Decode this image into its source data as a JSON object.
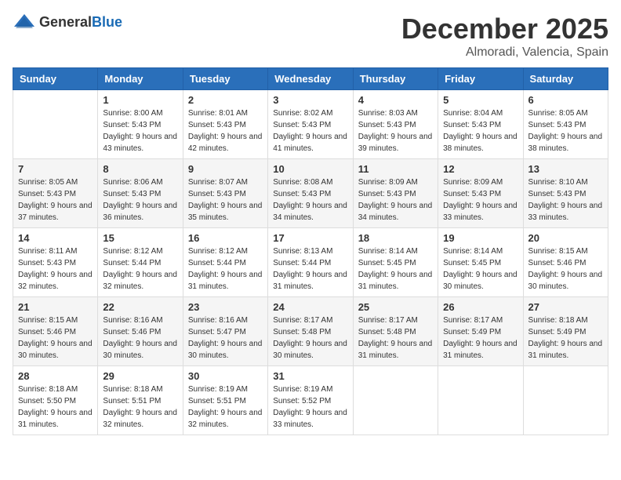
{
  "logo": {
    "general": "General",
    "blue": "Blue"
  },
  "header": {
    "month": "December 2025",
    "location": "Almoradi, Valencia, Spain"
  },
  "days_of_week": [
    "Sunday",
    "Monday",
    "Tuesday",
    "Wednesday",
    "Thursday",
    "Friday",
    "Saturday"
  ],
  "weeks": [
    [
      {
        "day": "",
        "sunrise": "",
        "sunset": "",
        "daylight": ""
      },
      {
        "day": "1",
        "sunrise": "Sunrise: 8:00 AM",
        "sunset": "Sunset: 5:43 PM",
        "daylight": "Daylight: 9 hours and 43 minutes."
      },
      {
        "day": "2",
        "sunrise": "Sunrise: 8:01 AM",
        "sunset": "Sunset: 5:43 PM",
        "daylight": "Daylight: 9 hours and 42 minutes."
      },
      {
        "day": "3",
        "sunrise": "Sunrise: 8:02 AM",
        "sunset": "Sunset: 5:43 PM",
        "daylight": "Daylight: 9 hours and 41 minutes."
      },
      {
        "day": "4",
        "sunrise": "Sunrise: 8:03 AM",
        "sunset": "Sunset: 5:43 PM",
        "daylight": "Daylight: 9 hours and 39 minutes."
      },
      {
        "day": "5",
        "sunrise": "Sunrise: 8:04 AM",
        "sunset": "Sunset: 5:43 PM",
        "daylight": "Daylight: 9 hours and 38 minutes."
      },
      {
        "day": "6",
        "sunrise": "Sunrise: 8:05 AM",
        "sunset": "Sunset: 5:43 PM",
        "daylight": "Daylight: 9 hours and 38 minutes."
      }
    ],
    [
      {
        "day": "7",
        "sunrise": "Sunrise: 8:05 AM",
        "sunset": "Sunset: 5:43 PM",
        "daylight": "Daylight: 9 hours and 37 minutes."
      },
      {
        "day": "8",
        "sunrise": "Sunrise: 8:06 AM",
        "sunset": "Sunset: 5:43 PM",
        "daylight": "Daylight: 9 hours and 36 minutes."
      },
      {
        "day": "9",
        "sunrise": "Sunrise: 8:07 AM",
        "sunset": "Sunset: 5:43 PM",
        "daylight": "Daylight: 9 hours and 35 minutes."
      },
      {
        "day": "10",
        "sunrise": "Sunrise: 8:08 AM",
        "sunset": "Sunset: 5:43 PM",
        "daylight": "Daylight: 9 hours and 34 minutes."
      },
      {
        "day": "11",
        "sunrise": "Sunrise: 8:09 AM",
        "sunset": "Sunset: 5:43 PM",
        "daylight": "Daylight: 9 hours and 34 minutes."
      },
      {
        "day": "12",
        "sunrise": "Sunrise: 8:09 AM",
        "sunset": "Sunset: 5:43 PM",
        "daylight": "Daylight: 9 hours and 33 minutes."
      },
      {
        "day": "13",
        "sunrise": "Sunrise: 8:10 AM",
        "sunset": "Sunset: 5:43 PM",
        "daylight": "Daylight: 9 hours and 33 minutes."
      }
    ],
    [
      {
        "day": "14",
        "sunrise": "Sunrise: 8:11 AM",
        "sunset": "Sunset: 5:43 PM",
        "daylight": "Daylight: 9 hours and 32 minutes."
      },
      {
        "day": "15",
        "sunrise": "Sunrise: 8:12 AM",
        "sunset": "Sunset: 5:44 PM",
        "daylight": "Daylight: 9 hours and 32 minutes."
      },
      {
        "day": "16",
        "sunrise": "Sunrise: 8:12 AM",
        "sunset": "Sunset: 5:44 PM",
        "daylight": "Daylight: 9 hours and 31 minutes."
      },
      {
        "day": "17",
        "sunrise": "Sunrise: 8:13 AM",
        "sunset": "Sunset: 5:44 PM",
        "daylight": "Daylight: 9 hours and 31 minutes."
      },
      {
        "day": "18",
        "sunrise": "Sunrise: 8:14 AM",
        "sunset": "Sunset: 5:45 PM",
        "daylight": "Daylight: 9 hours and 31 minutes."
      },
      {
        "day": "19",
        "sunrise": "Sunrise: 8:14 AM",
        "sunset": "Sunset: 5:45 PM",
        "daylight": "Daylight: 9 hours and 30 minutes."
      },
      {
        "day": "20",
        "sunrise": "Sunrise: 8:15 AM",
        "sunset": "Sunset: 5:46 PM",
        "daylight": "Daylight: 9 hours and 30 minutes."
      }
    ],
    [
      {
        "day": "21",
        "sunrise": "Sunrise: 8:15 AM",
        "sunset": "Sunset: 5:46 PM",
        "daylight": "Daylight: 9 hours and 30 minutes."
      },
      {
        "day": "22",
        "sunrise": "Sunrise: 8:16 AM",
        "sunset": "Sunset: 5:46 PM",
        "daylight": "Daylight: 9 hours and 30 minutes."
      },
      {
        "day": "23",
        "sunrise": "Sunrise: 8:16 AM",
        "sunset": "Sunset: 5:47 PM",
        "daylight": "Daylight: 9 hours and 30 minutes."
      },
      {
        "day": "24",
        "sunrise": "Sunrise: 8:17 AM",
        "sunset": "Sunset: 5:48 PM",
        "daylight": "Daylight: 9 hours and 30 minutes."
      },
      {
        "day": "25",
        "sunrise": "Sunrise: 8:17 AM",
        "sunset": "Sunset: 5:48 PM",
        "daylight": "Daylight: 9 hours and 31 minutes."
      },
      {
        "day": "26",
        "sunrise": "Sunrise: 8:17 AM",
        "sunset": "Sunset: 5:49 PM",
        "daylight": "Daylight: 9 hours and 31 minutes."
      },
      {
        "day": "27",
        "sunrise": "Sunrise: 8:18 AM",
        "sunset": "Sunset: 5:49 PM",
        "daylight": "Daylight: 9 hours and 31 minutes."
      }
    ],
    [
      {
        "day": "28",
        "sunrise": "Sunrise: 8:18 AM",
        "sunset": "Sunset: 5:50 PM",
        "daylight": "Daylight: 9 hours and 31 minutes."
      },
      {
        "day": "29",
        "sunrise": "Sunrise: 8:18 AM",
        "sunset": "Sunset: 5:51 PM",
        "daylight": "Daylight: 9 hours and 32 minutes."
      },
      {
        "day": "30",
        "sunrise": "Sunrise: 8:19 AM",
        "sunset": "Sunset: 5:51 PM",
        "daylight": "Daylight: 9 hours and 32 minutes."
      },
      {
        "day": "31",
        "sunrise": "Sunrise: 8:19 AM",
        "sunset": "Sunset: 5:52 PM",
        "daylight": "Daylight: 9 hours and 33 minutes."
      },
      {
        "day": "",
        "sunrise": "",
        "sunset": "",
        "daylight": ""
      },
      {
        "day": "",
        "sunrise": "",
        "sunset": "",
        "daylight": ""
      },
      {
        "day": "",
        "sunrise": "",
        "sunset": "",
        "daylight": ""
      }
    ]
  ]
}
